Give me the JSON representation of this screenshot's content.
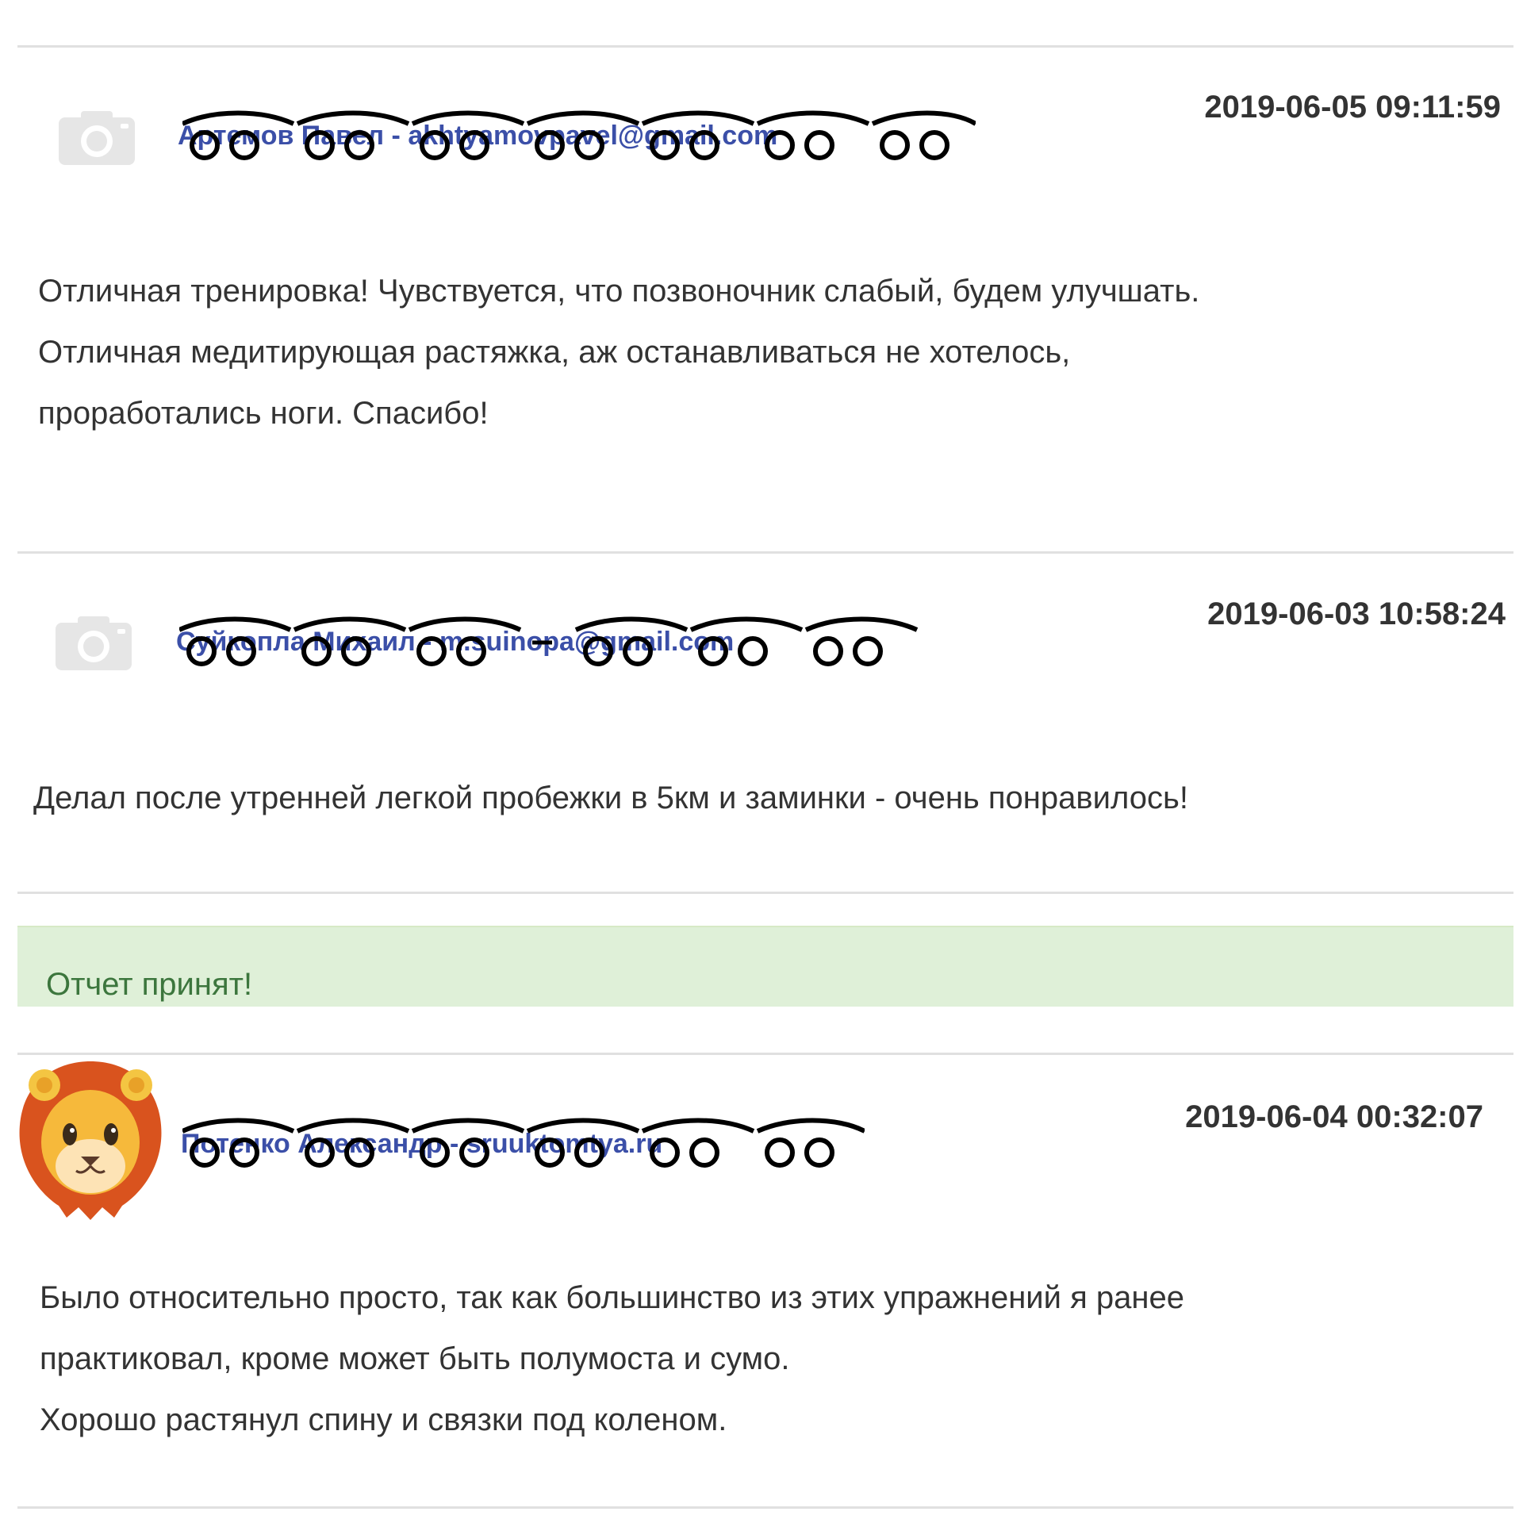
{
  "comments": [
    {
      "author": "Артемов Павел - akhtyamovpavel@gmail.com",
      "date": "2019-06-05 09:11:59",
      "avatar": "camera-placeholder-icon",
      "lines": [
        "Отличная тренировка! Чувствуется, что позвоночник слабый, будем улучшать.",
        "Отличная медитирующая растяжка, аж останавливаться не хотелось,",
        "проработались ноги. Спасибо!"
      ]
    },
    {
      "author": "Суйкопла Михаил - m.suinopa@gmail.com",
      "date": "2019-06-03 10:58:24",
      "avatar": "camera-placeholder-icon",
      "lines": [
        "Делал после утренней легкой пробежки в 5км и заминки - очень понравилось!"
      ]
    },
    {
      "author": "Потенко Александр - sruuktomtya.ru",
      "date": "2019-06-04 00:32:07",
      "avatar": "lion-emoji-avatar",
      "lines": [
        "Было относительно просто, так как большинство из этих упражнений я ранее",
        "практиковал, кроме может быть полумоста и сумо.",
        "Хорошо растянул спину и связки под коленом."
      ]
    }
  ],
  "alert": {
    "text": "Отчет принят!",
    "color": "#3c763d",
    "background": "#dff0d8"
  }
}
